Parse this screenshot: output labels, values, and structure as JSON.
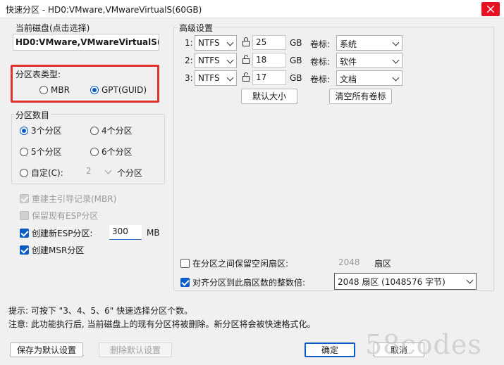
{
  "window": {
    "title": "快速分区 - HD0:VMware,VMwareVirtualS(60GB)"
  },
  "disk": {
    "label": "当前磁盘(点击选择)",
    "value": "HD0:VMware,VMwareVirtualS("
  },
  "partition_table": {
    "label": "分区表类型:",
    "options": [
      "MBR",
      "GPT(GUID)"
    ],
    "selected": "GPT(GUID)"
  },
  "partition_count": {
    "label": "分区数目",
    "options": [
      "3个分区",
      "4个分区",
      "5个分区",
      "6个分区"
    ],
    "selected": "3个分区",
    "custom_label": "自定(C):",
    "custom_value": "2",
    "custom_suffix": "个分区"
  },
  "options": {
    "rebuild_mbr": "重建主引导记录(MBR)",
    "keep_esp": "保留现有ESP分区",
    "create_esp": "创建新ESP分区:",
    "esp_size": "300",
    "esp_unit": "MB",
    "create_msr": "创建MSR分区"
  },
  "advanced": {
    "label": "高级设置",
    "rows": [
      {
        "index": "1:",
        "fs": "NTFS",
        "size": "25",
        "unit": "GB",
        "vol_label": "卷标:",
        "vol_value": "系统"
      },
      {
        "index": "2:",
        "fs": "NTFS",
        "size": "18",
        "unit": "GB",
        "vol_label": "卷标:",
        "vol_value": "软件"
      },
      {
        "index": "3:",
        "fs": "NTFS",
        "size": "17",
        "unit": "GB",
        "vol_label": "卷标:",
        "vol_value": "文档"
      }
    ],
    "default_size_btn": "默认大小",
    "clear_labels_btn": "清空所有卷标"
  },
  "gaps": {
    "keep_free_label": "在分区之间保留空闲扇区:",
    "keep_free_value": "2048",
    "keep_free_unit": "扇区",
    "align_label": "对齐分区到此扇区数的整数倍:",
    "align_value": "2048 扇区 (1048576 字节)"
  },
  "hints": {
    "tip": "提示: 可按下 \"3、4、5、6\" 快速选择分区个数。",
    "note": "注意: 此功能执行后, 当前磁盘上的现有分区将被删除。新分区将会被快速格式化。"
  },
  "buttons": {
    "save_default": "保存为默认设置",
    "delete_default": "删除默认设置",
    "ok": "确定",
    "cancel": "取消"
  },
  "watermark": "58codes",
  "colors": {
    "accent": "#0a5bc4",
    "highlight_frame": "#e0312e",
    "close": "#e81123"
  }
}
